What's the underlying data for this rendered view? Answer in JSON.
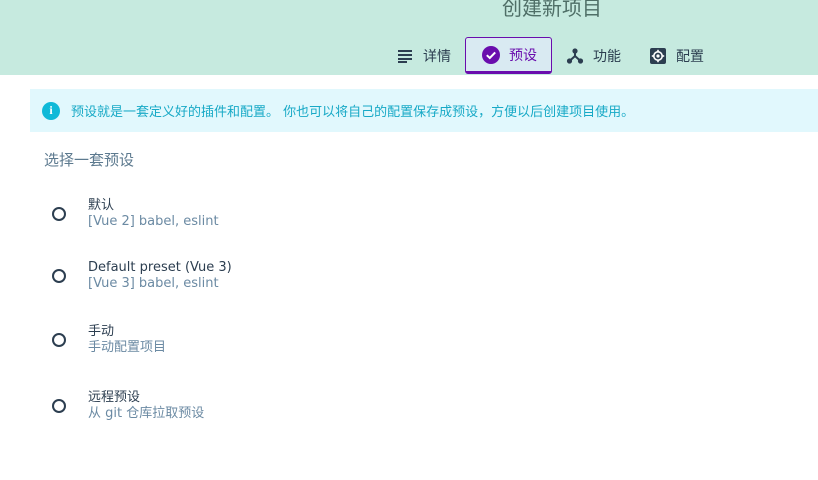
{
  "header": {
    "title": "创建新项目",
    "tabs": [
      {
        "label": "详情",
        "icon": "list-icon"
      },
      {
        "label": "预设",
        "icon": "check-circle-icon",
        "active": true
      },
      {
        "label": "功能",
        "icon": "branch-icon"
      },
      {
        "label": "配置",
        "icon": "gear-icon"
      }
    ]
  },
  "info": {
    "text": "预设就是一套定义好的插件和配置。 你也可以将自己的配置保存成预设，方便以后创建项目使用。"
  },
  "presets": {
    "title": "选择一套预设",
    "items": [
      {
        "name": "默认",
        "desc": "[Vue 2] babel, eslint"
      },
      {
        "name": "Default preset (Vue 3)",
        "desc": "[Vue 3] babel, eslint"
      },
      {
        "name": "手动",
        "desc": "手动配置项目"
      },
      {
        "name": "远程预设",
        "desc": "从 git 仓库拉取预设"
      }
    ]
  },
  "colors": {
    "header_bg": "#c6eadf",
    "accent": "#6a0dad",
    "info_bg": "#e1f8fd",
    "info_text": "#17a9c6"
  }
}
